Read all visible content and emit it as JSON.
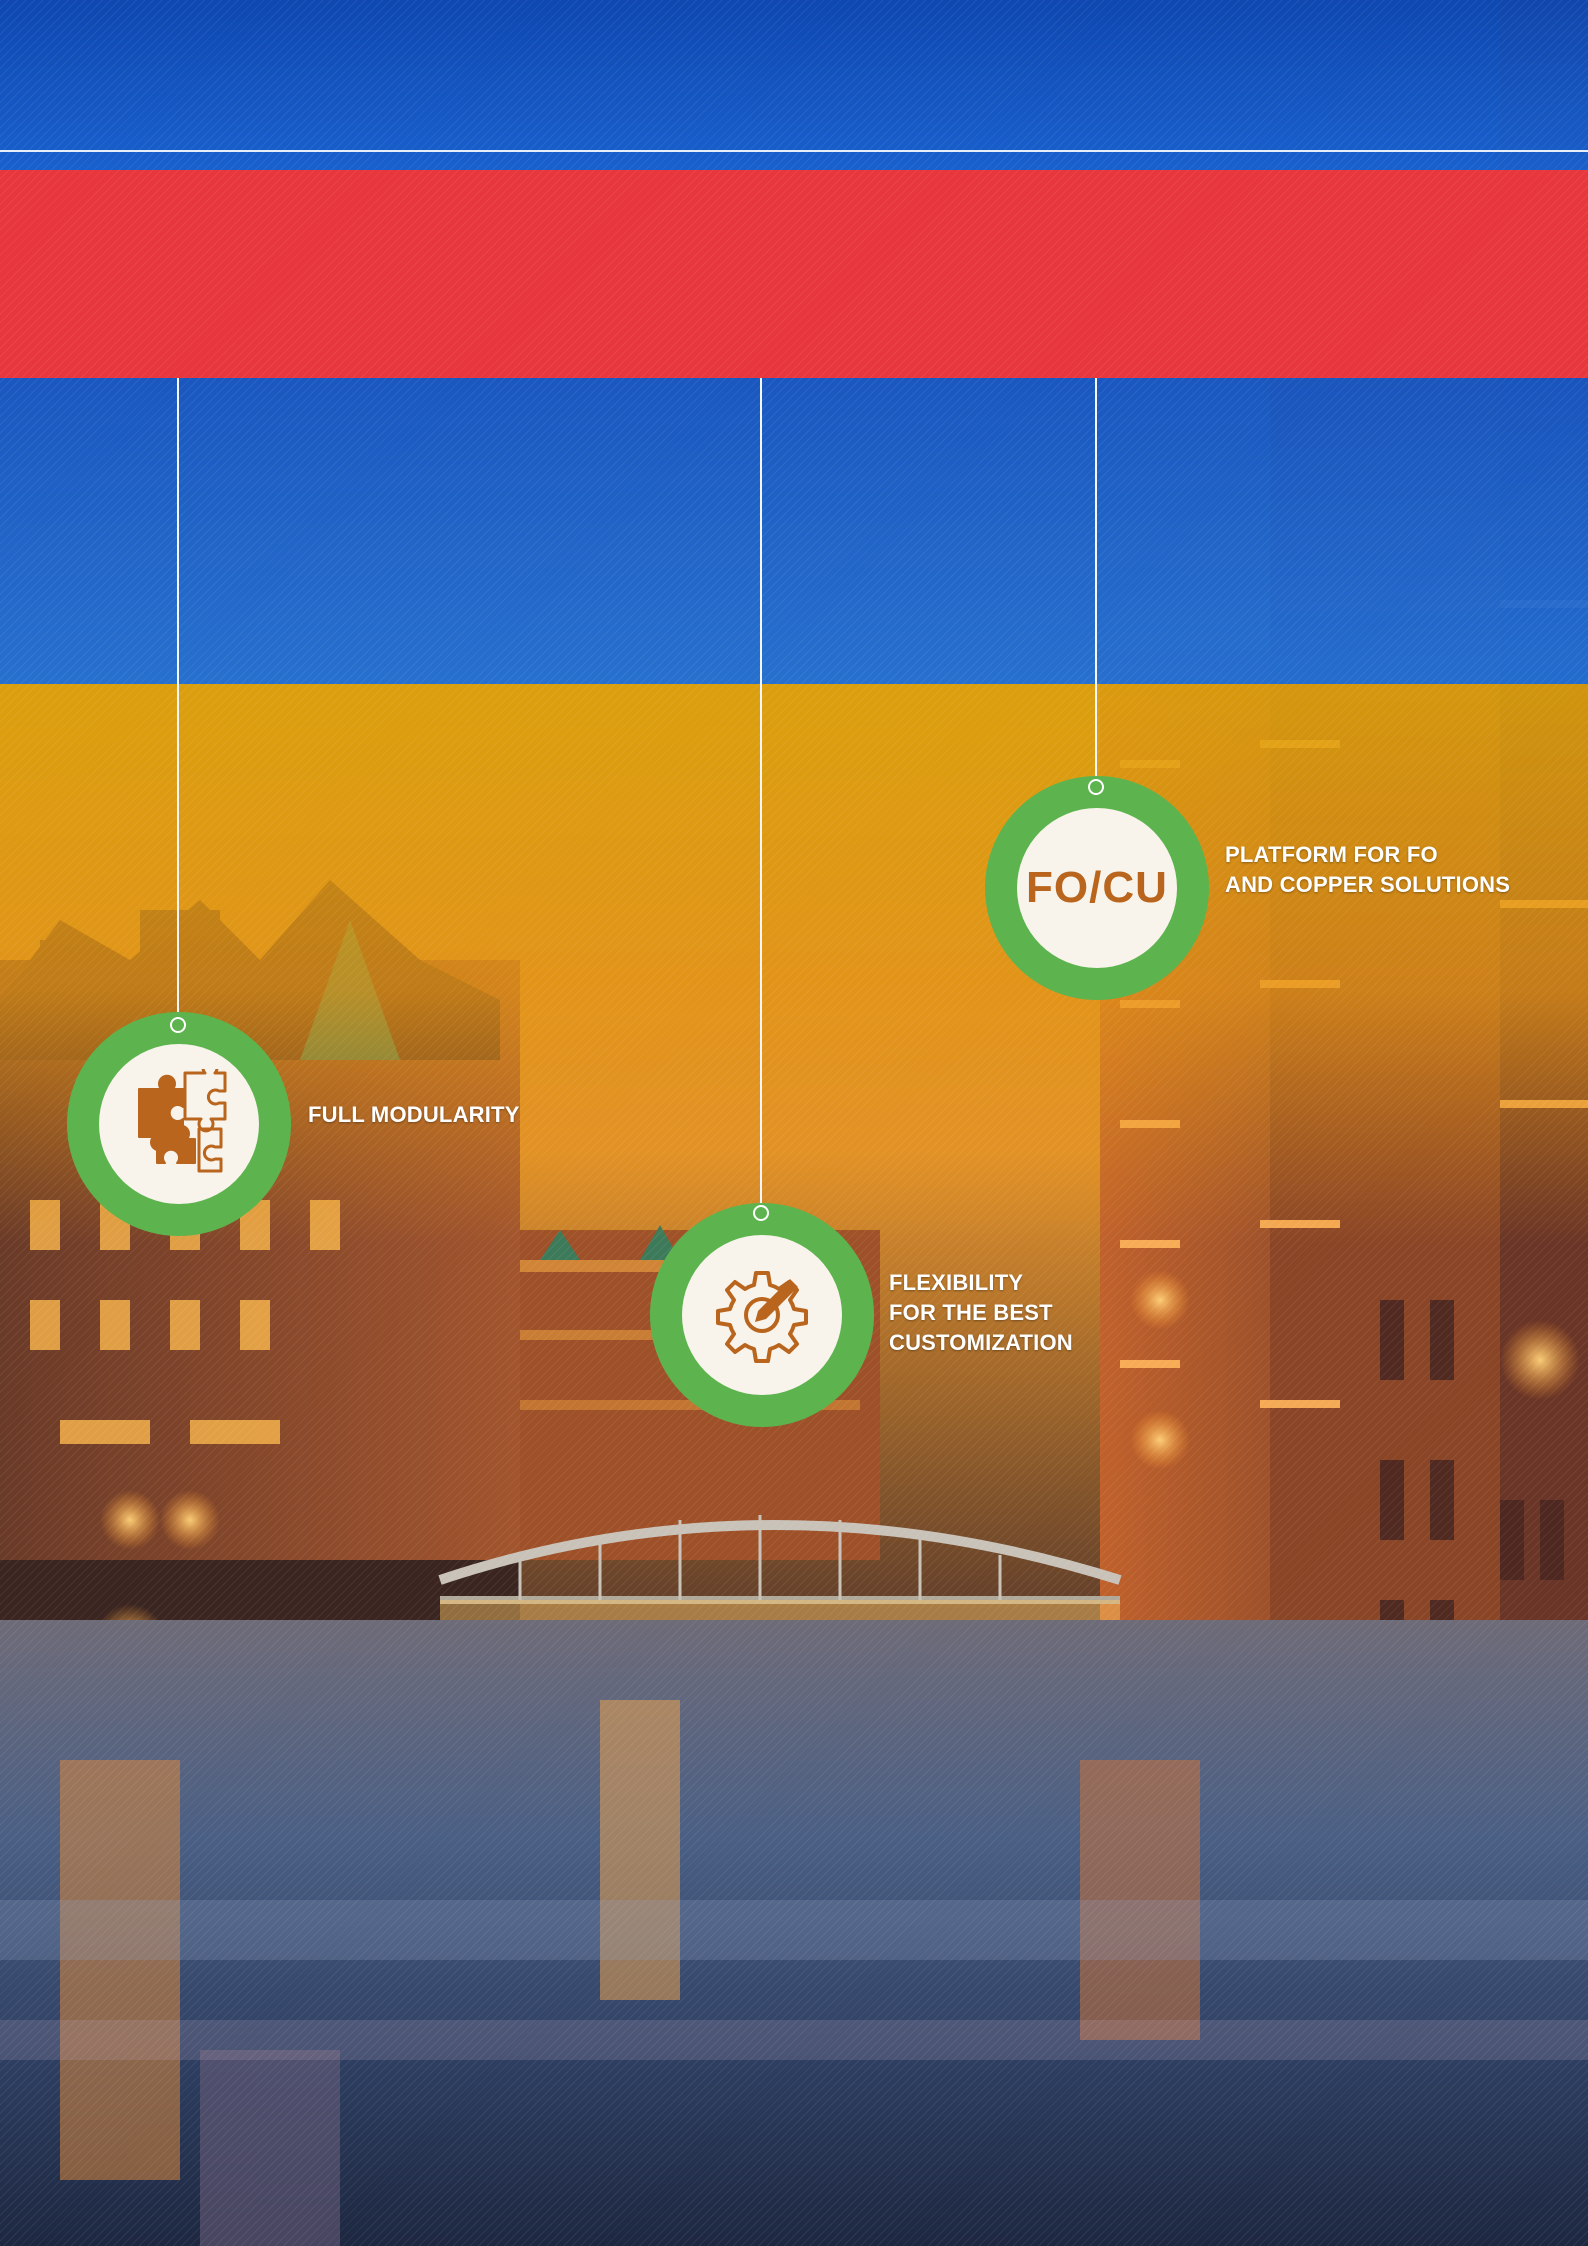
{
  "colors": {
    "top_band": "#1760cf",
    "red_band": "#e8363d",
    "mid_band": "#1f6fd6",
    "yellow_band": "#dea20a",
    "badge_ring": "#5db44e",
    "badge_fill": "#f8f4ec",
    "icon_color": "#b9651d"
  },
  "features": [
    {
      "id": "modularity",
      "icon": "puzzle-icon",
      "lines": [
        "FULL MODULARITY"
      ]
    },
    {
      "id": "flexibility",
      "icon": "gear-pencil-icon",
      "lines": [
        "FLEXIBILITY",
        "FOR THE BEST",
        "CUSTOMIZATION"
      ]
    },
    {
      "id": "platform",
      "icon_text": "FO/CU",
      "lines": [
        "PLATFORM FOR FO",
        "AND COPPER SOLUTIONS"
      ]
    }
  ]
}
